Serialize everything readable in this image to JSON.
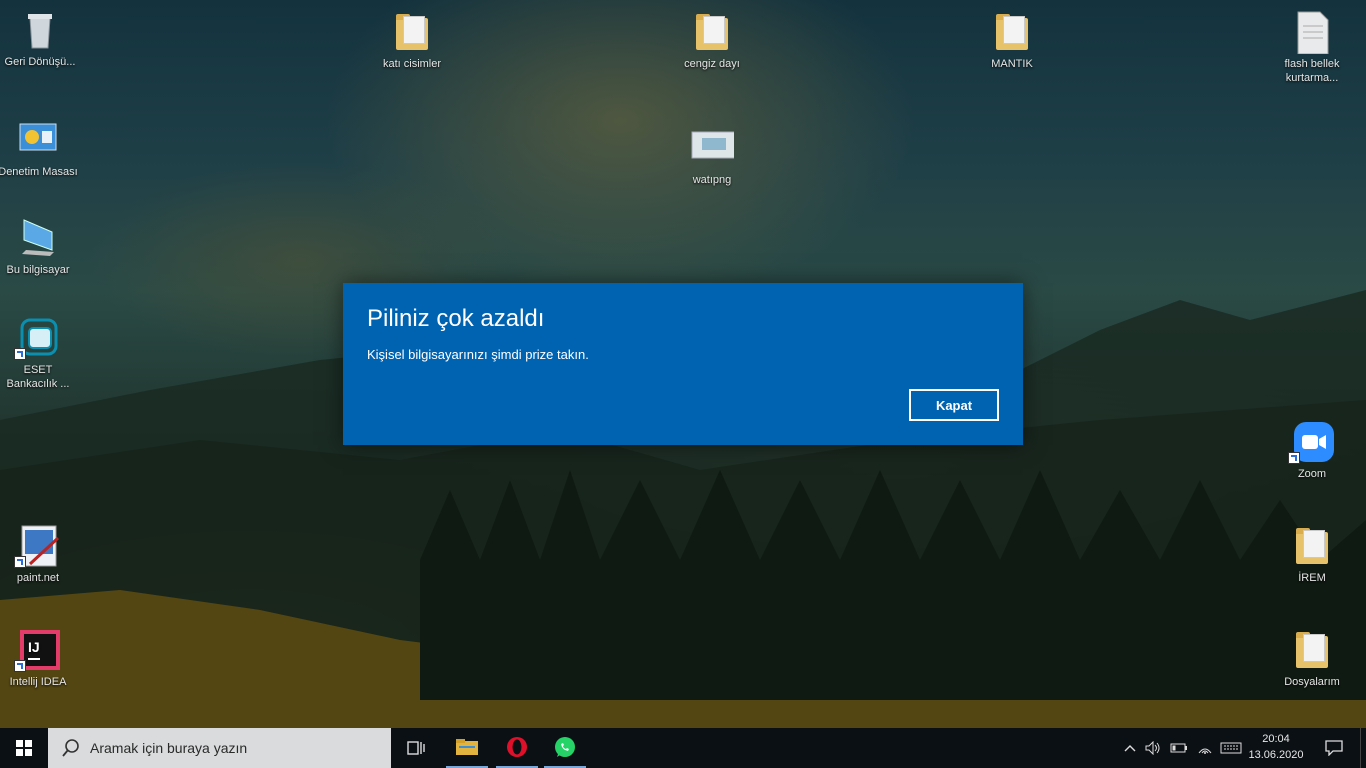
{
  "desktop": {
    "icons": [
      {
        "label": "Geri Dönüşü..."
      },
      {
        "label": "Denetim Masası"
      },
      {
        "label": "Bu bilgisayar"
      },
      {
        "label": "ESET Bankacılık ..."
      },
      {
        "label": "paint.net"
      },
      {
        "label": "Intellij IDEA"
      },
      {
        "label": "katı cisimler"
      },
      {
        "label": "cengiz dayı"
      },
      {
        "label": "watıpng"
      },
      {
        "label": "MANTIK"
      },
      {
        "label": "flash bellek kurtarma..."
      },
      {
        "label": "Zoom"
      },
      {
        "label": "İREM"
      },
      {
        "label": "Dosyalarım"
      }
    ]
  },
  "dialog": {
    "title": "Piliniz çok azaldı",
    "message": "Kişisel bilgisayarınızı şimdi prize takın.",
    "close_button": "Kapat",
    "color": "#0063b1"
  },
  "taskbar": {
    "search_placeholder": "Aramak için buraya yazın",
    "pinned": [
      "task-view-icon",
      "file-explorer-icon",
      "opera-icon",
      "whatsapp-icon"
    ],
    "clock_time": "20:04",
    "clock_date": "13.06.2020"
  }
}
